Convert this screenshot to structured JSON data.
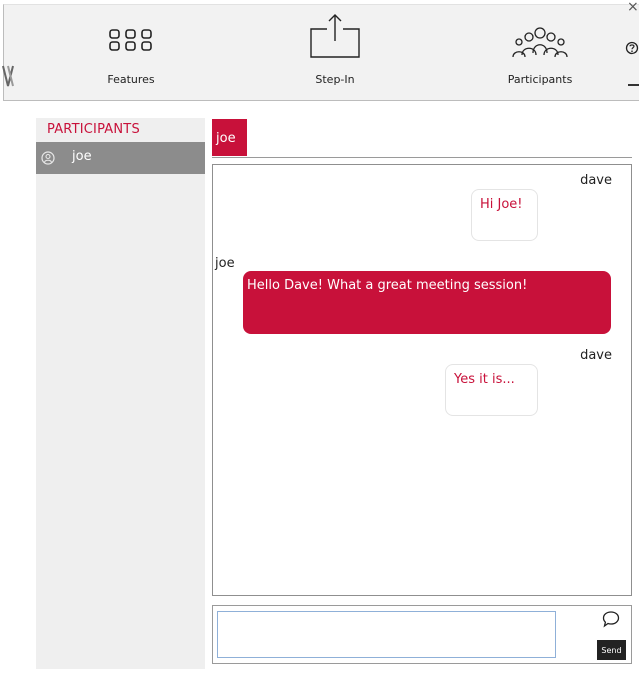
{
  "toolbar": {
    "features_label": "Features",
    "stepin_label": "Step-In",
    "participants_label": "Participants",
    "close_glyph": "×",
    "icons": {
      "features": "grid-icon",
      "stepin": "share-upload-icon",
      "participants": "people-group-icon",
      "help": "help-icon",
      "close": "close-icon",
      "minimize": "minimize-icon",
      "logo": "brand-logo"
    }
  },
  "sidebar": {
    "title": "PARTICIPANTS",
    "participants": [
      {
        "name": "joe",
        "icon": "user-icon"
      }
    ]
  },
  "chat": {
    "active_tab": "joe",
    "messages": [
      {
        "sender": "dave",
        "text": "Hi Joe!",
        "direction": "incoming"
      },
      {
        "sender": "joe",
        "text": "Hello Dave! What a great meeting session!",
        "direction": "outgoing"
      },
      {
        "sender": "dave",
        "text": "Yes it is...",
        "direction": "incoming"
      }
    ]
  },
  "composer": {
    "input_value": "",
    "send_label": "Send",
    "emote_icon": "chat-bubble-icon"
  },
  "colors": {
    "accent": "#c8113a",
    "sidebar_bg": "#efefef",
    "selected_bg": "#8c8c8c",
    "toolbar_bg": "#f2f2f2"
  }
}
